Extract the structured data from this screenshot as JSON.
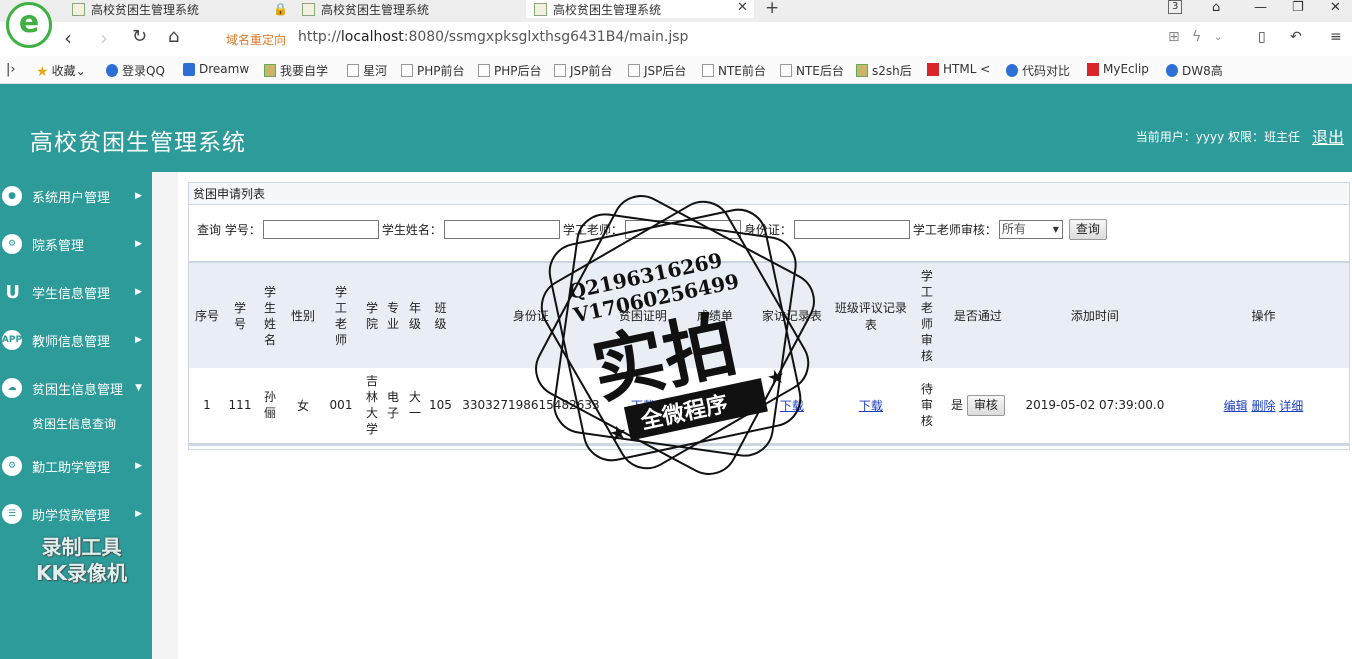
{
  "browser": {
    "tabs": [
      {
        "label": "高校贫困生管理系统"
      },
      {
        "label": "高校贫困生管理系统"
      },
      {
        "label": "高校贫困生管理系统"
      }
    ],
    "tab_count": "3",
    "redirect_label": "域名重定向",
    "url_prefix": "http://",
    "url_host": "localhost",
    "url_rest": ":8080/ssmgxpksglxthsg6431B4/main.jsp",
    "bookmarks": [
      "收藏",
      "登录QQ",
      "Dreamw",
      "我要自学",
      "星河",
      "PHP前台",
      "PHP后台",
      "JSP前台",
      "JSP后台",
      "NTE前台",
      "NTE后台",
      "s2sh后",
      "HTML <",
      "代码对比",
      "MyEclip",
      "DW8高"
    ]
  },
  "header": {
    "title": "高校贫困生管理系统",
    "user_info": "当前用户：yyyy 权限：班主任",
    "logout": "退出"
  },
  "sidebar": {
    "items": [
      {
        "label": "系统用户管理",
        "icon": "user-icon"
      },
      {
        "label": "院系管理",
        "icon": "users-gear-icon"
      },
      {
        "label": "学生信息管理",
        "icon": "magnet-icon"
      },
      {
        "label": "教师信息管理",
        "icon": "app-icon"
      },
      {
        "label": "贫困生信息管理",
        "icon": "cloud-icon"
      },
      {
        "label": "勤工助学管理",
        "icon": "gear-icon"
      },
      {
        "label": "助学贷款管理",
        "icon": "stack-icon"
      }
    ],
    "sub_item": "贫困生信息查询",
    "watermark_line1": "录制工具",
    "watermark_line2": "KK录像机"
  },
  "panel": {
    "title": "贫困申请列表",
    "search": {
      "query_label": "查询",
      "xuehao_label": "学号：",
      "name_label": "学生姓名：",
      "teacher_label": "学工老师：",
      "idcard_label": "身份证：",
      "review_label": "学工老师审核：",
      "review_value": "所有",
      "button": "查询"
    },
    "columns": [
      "序号",
      "学号",
      "学生姓名",
      "性别",
      "学工老师",
      "学院",
      "专业",
      "年级",
      "班级",
      "身份证",
      "贫困证明",
      "成绩单",
      "家访记录表",
      "班级评议记录表",
      "学工老师审核",
      "是否通过",
      "添加时间",
      "操作"
    ],
    "rows": [
      {
        "index": "1",
        "xuehao": "111",
        "name": "孙俪",
        "gender": "女",
        "teacher": "001",
        "college": "吉林大学",
        "major": "电子",
        "grade": "大一",
        "class": "105",
        "idcard": "330327198615482633",
        "proof": "下载",
        "transcript": "下载",
        "visit": "下载",
        "review_record": "下载",
        "audit": "待审核",
        "passed": "是",
        "audit_button": "审核",
        "added": "2019-05-02 07:39:00.0",
        "action_edit": "编辑",
        "action_delete": "删除",
        "action_detail": "详细"
      }
    ]
  },
  "stamp": {
    "line1": "Q2196316269",
    "line2": "V17060256499",
    "big": "实拍",
    "banner": "全微程序"
  },
  "colors": {
    "theme": "#2d9b99",
    "link": "#1a3fc0"
  }
}
